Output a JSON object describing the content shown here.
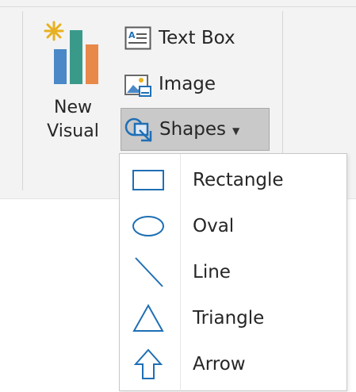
{
  "ribbon": {
    "new_visual_label": "New\nVisual",
    "text_box_label": "Text Box",
    "image_label": "Image",
    "shapes_label": "Shapes",
    "icons": {
      "new_visual": "bar-chart-sparkle-icon",
      "text_box": "text-box-icon",
      "image": "image-icon",
      "shapes": "shapes-icon",
      "caret": "chevron-down-icon"
    }
  },
  "shapes_menu": {
    "items": [
      {
        "label": "Rectangle",
        "icon": "rectangle-icon"
      },
      {
        "label": "Oval",
        "icon": "oval-icon"
      },
      {
        "label": "Line",
        "icon": "line-icon"
      },
      {
        "label": "Triangle",
        "icon": "triangle-icon"
      },
      {
        "label": "Arrow",
        "icon": "arrow-up-icon"
      }
    ]
  },
  "colors": {
    "accent_blue": "#1f6fb5",
    "bar_blue": "#4a88c7",
    "bar_teal": "#3a9a8a",
    "bar_orange": "#e8894a",
    "sparkle": "#e8b020",
    "selected_button_bg": "#c9c9c9"
  }
}
